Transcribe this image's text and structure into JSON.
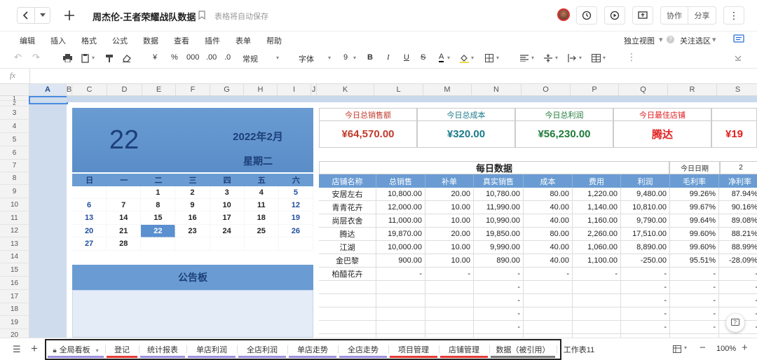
{
  "doc": {
    "title": "周杰伦-王者荣耀战队数据",
    "autosave": "表格将自动保存"
  },
  "header": {
    "collab": "协作",
    "share": "分享"
  },
  "menu": [
    "编辑",
    "插入",
    "格式",
    "公式",
    "数据",
    "查看",
    "插件",
    "表单",
    "帮助"
  ],
  "menu_right": {
    "view": "独立视图",
    "follow": "关注选区"
  },
  "toolbar": {
    "yen": "¥",
    "percent": "%",
    "thousands": "000",
    "dec_inc": ".00",
    "dec_dec": ".0",
    "format": "常规",
    "font": "字体",
    "size": "9",
    "bold": "B",
    "italic": "I",
    "underline": "U",
    "strike": "S",
    "color_a": "A"
  },
  "fx": "fx",
  "columns": [
    "A",
    "B",
    "C",
    "D",
    "E",
    "F",
    "G",
    "H",
    "I",
    "J",
    "K",
    "L",
    "M",
    "N",
    "O",
    "P",
    "Q",
    "R",
    "S"
  ],
  "rows": [
    "1",
    "2",
    "3",
    "4",
    "5",
    "6",
    "7",
    "8",
    "9",
    "10",
    "11",
    "12",
    "13",
    "14",
    "15",
    "16",
    "17",
    "18",
    "19",
    "20"
  ],
  "calendar": {
    "day": "22",
    "month": "2022年2月",
    "weekday": "星期二",
    "weekdays": [
      "日",
      "一",
      "二",
      "三",
      "四",
      "五",
      "六"
    ],
    "weeks": [
      [
        "",
        "",
        "1",
        "2",
        "3",
        "4",
        "5"
      ],
      [
        "6",
        "7",
        "8",
        "9",
        "10",
        "11",
        "12"
      ],
      [
        "13",
        "14",
        "15",
        "16",
        "17",
        "18",
        "19"
      ],
      [
        "20",
        "21",
        "22",
        "23",
        "24",
        "25",
        "26"
      ],
      [
        "27",
        "28",
        "",
        "",
        "",
        "",
        ""
      ]
    ],
    "highlight": "22",
    "board": "公告板"
  },
  "kpi": [
    {
      "label": "今日总销售额",
      "value": "¥64,570.00",
      "color": "#c0392b"
    },
    {
      "label": "今日总成本",
      "value": "¥320.00",
      "color": "#1a7a8a"
    },
    {
      "label": "今日总利润",
      "value": "¥56,230.00",
      "color": "#1e7b3a"
    },
    {
      "label": "今日最佳店铺",
      "value": "腾达",
      "color": "#e02020"
    },
    {
      "label": "",
      "value": "¥19",
      "color": "#e02020"
    }
  ],
  "daily": {
    "title": "每日数据",
    "date_label": "今日日期",
    "date_value": "2",
    "headers": [
      "店铺名称",
      "总销售",
      "补单",
      "真实销售",
      "成本",
      "费用",
      "利润",
      "毛利率",
      "净利率"
    ],
    "rows": [
      [
        "安居左右",
        "10,800.00",
        "20.00",
        "10,780.00",
        "80.00",
        "1,220.00",
        "9,480.00",
        "99.26%",
        "87.94%"
      ],
      [
        "青青花卉",
        "12,000.00",
        "10.00",
        "11,990.00",
        "40.00",
        "1,140.00",
        "10,810.00",
        "99.67%",
        "90.16%"
      ],
      [
        "尚层衣舍",
        "11,000.00",
        "10.00",
        "10,990.00",
        "40.00",
        "1,160.00",
        "9,790.00",
        "99.64%",
        "89.08%"
      ],
      [
        "腾达",
        "19,870.00",
        "20.00",
        "19,850.00",
        "80.00",
        "2,260.00",
        "17,510.00",
        "99.60%",
        "88.21%"
      ],
      [
        "江湖",
        "10,000.00",
        "10.00",
        "9,990.00",
        "40.00",
        "1,060.00",
        "8,890.00",
        "99.60%",
        "88.99%"
      ],
      [
        "金巴黎",
        "900.00",
        "10.00",
        "890.00",
        "40.00",
        "1,100.00",
        "-250.00",
        "95.51%",
        "-28.09%"
      ],
      [
        "柏醯花卉",
        "-",
        "-",
        "-",
        "-",
        "-",
        "-",
        "-",
        "-"
      ],
      [
        "",
        "",
        "",
        "-",
        "",
        "",
        "-",
        "-",
        "-"
      ],
      [
        "",
        "",
        "",
        "-",
        "",
        "",
        "-",
        "-",
        "-"
      ],
      [
        "",
        "",
        "",
        "-",
        "",
        "",
        "-",
        "-",
        "-"
      ],
      [
        "",
        "",
        "",
        "-",
        "",
        "",
        "-",
        "-",
        "-"
      ],
      [
        "",
        "",
        "",
        "-",
        "",
        "",
        "-",
        "-",
        "-"
      ]
    ]
  },
  "sheets": [
    {
      "name": "全局看板",
      "color": "#9b8fe0"
    },
    {
      "name": "登记",
      "color": "#e53935"
    },
    {
      "name": "统计报表",
      "color": "#9b8fe0"
    },
    {
      "name": "单店利润",
      "color": "#9b8fe0"
    },
    {
      "name": "全店利润",
      "color": "#9b8fe0"
    },
    {
      "name": "单店走势",
      "color": "#9b8fe0"
    },
    {
      "name": "全店走势",
      "color": "#9b8fe0"
    },
    {
      "name": "项目管理",
      "color": "#e53935"
    },
    {
      "name": "店铺管理",
      "color": "#e53935"
    },
    {
      "name": "数据（被引用）",
      "color": "#777777"
    },
    {
      "name": "工作表11",
      "color": ""
    }
  ],
  "zoom": "100%"
}
